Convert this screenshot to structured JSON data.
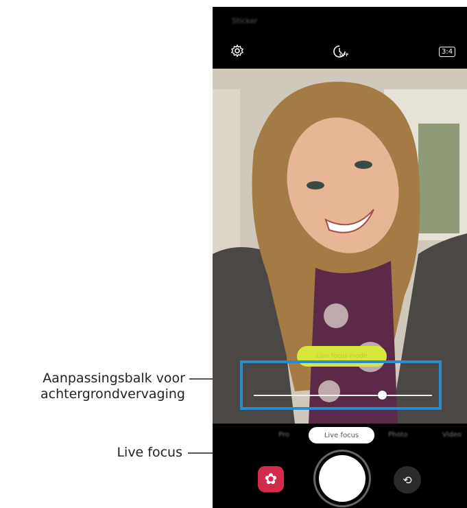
{
  "callouts": {
    "blur_bar": "Aanpassingsbalk voor achtergrondvervaging",
    "live_focus": "Live focus"
  },
  "camera": {
    "status_text": "Sticker",
    "aspect_ratio": "3:4",
    "timer_label": "OFF",
    "tag_pill": "Live focus mode",
    "blur_level": 0.72,
    "modes": [
      "Pro",
      "Live focus",
      "Photo",
      "Video"
    ],
    "active_mode": "Live focus"
  },
  "icons": {
    "settings": "gear-icon",
    "timer": "timer-icon",
    "effects": "flower-icon",
    "switch_camera": "switch-camera-icon"
  }
}
